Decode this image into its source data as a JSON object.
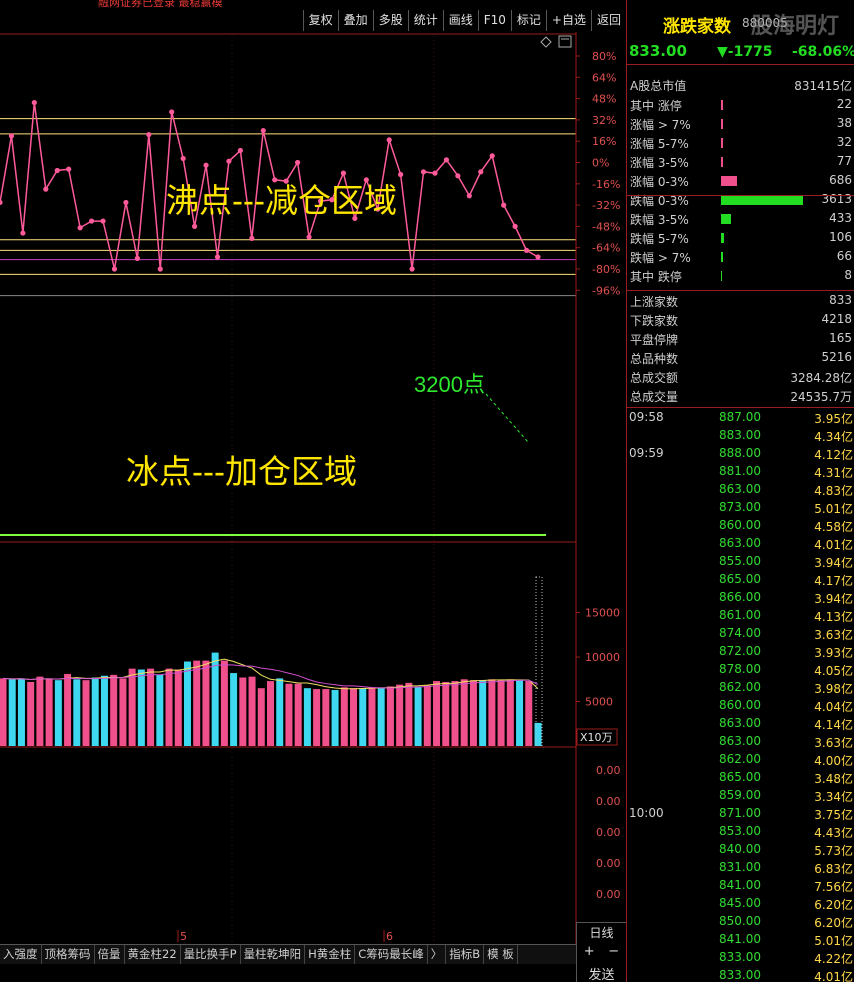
{
  "topbar": {
    "red_text": "融网证券已登录 最稳赢模",
    "buttons": [
      "复权",
      "叠加",
      "多股",
      "统计",
      "画线",
      "F10",
      "标记",
      "+自选",
      "返回"
    ]
  },
  "annotations": {
    "boil": "沸点---减仓区域",
    "ice": "冰点---加仓区域",
    "point_3200": "3200点"
  },
  "y_axis_labels": [
    "80%",
    "64%",
    "48%",
    "32%",
    "16%",
    "0%",
    "-16%",
    "-32%",
    "-48%",
    "-64%",
    "-80%",
    "-96%"
  ],
  "volume_axis": {
    "labels": [
      "15000",
      "10000",
      "5000"
    ],
    "unit": "X10万"
  },
  "indicator_axis_labels": [
    "0.00",
    "0.00",
    "0.00",
    "0.00",
    "0.00"
  ],
  "date_labels": [
    "5",
    "6"
  ],
  "bottom_tabs": [
    "入强度",
    "顶格筹码",
    "倍量",
    "黄金柱22",
    "量比换手P",
    "量柱乾坤阳",
    "H黄金柱",
    "C筹码最长峰",
    "〉",
    "指标B",
    "模 板"
  ],
  "bottom_right": {
    "line_label": "日线",
    "send_label": "发送",
    "plus": "+",
    "minus": "−"
  },
  "colors": {
    "up": "#f0508c",
    "down": "#3ed8f0",
    "band_yellow": "#ffe27a",
    "band_magenta": "#c640c0",
    "band_green": "#80ff40",
    "line": "#ff5a9a"
  },
  "chart_data": {
    "type": "line",
    "series": [
      {
        "values": [
          -30,
          20,
          -53,
          45,
          -20,
          -6,
          -5,
          -49,
          -44,
          -44,
          -80,
          -30,
          -72,
          21,
          -80,
          38,
          3,
          -48,
          -2,
          -71,
          1,
          9,
          -57,
          24,
          -13,
          -14,
          0,
          -56,
          -29,
          -28,
          -8,
          -42,
          -13,
          -35,
          17,
          -9,
          -80,
          -7,
          -8,
          2,
          -10,
          -25,
          -7,
          5,
          -32,
          -48,
          -66,
          -71
        ]
      }
    ],
    "ylim": [
      -104,
      88
    ],
    "volume": [
      7600,
      7500,
      7600,
      7200,
      7800,
      7600,
      7400,
      8100,
      7500,
      7400,
      7700,
      7900,
      8000,
      7600,
      8700,
      8600,
      8700,
      8000,
      8700,
      8600,
      9500,
      9600,
      9600,
      10500,
      9600,
      8200,
      7700,
      7800,
      6500,
      7300,
      7600,
      7000,
      7000,
      6500,
      6400,
      6400,
      6300,
      6600,
      6500,
      6500,
      6600,
      6500,
      6700,
      6900,
      7100,
      6700,
      6800,
      7300,
      7200,
      7300,
      7500,
      7400,
      7400,
      7500,
      7400,
      7500,
      7400,
      7300,
      2600
    ],
    "volume_up": [
      1,
      0,
      0,
      1,
      1,
      1,
      0,
      1,
      0,
      1,
      0,
      0,
      1,
      1,
      1,
      0,
      1,
      0,
      1,
      1,
      0,
      1,
      1,
      0,
      1,
      0,
      1,
      1,
      1,
      1,
      0,
      1,
      1,
      0,
      1,
      1,
      0,
      1,
      1,
      0,
      1,
      0,
      1,
      1,
      1,
      0,
      1,
      1,
      1,
      1,
      1,
      1,
      0,
      1,
      1,
      1,
      0,
      1,
      0
    ],
    "volume_ylim": [
      0,
      19000
    ]
  },
  "right_panel": {
    "title": "涨跌家数",
    "code": "880005",
    "watermark": "股海明灯",
    "value": "833.00",
    "change": "▼-1775",
    "pct": "-68.06%",
    "market_cap": {
      "label": "A股总市值",
      "value": "831415亿"
    },
    "rows": [
      {
        "label": "其中 涨停",
        "value": "22",
        "bar": 2,
        "color": "#f0508c"
      },
      {
        "label": "涨幅 > 7%",
        "value": "38",
        "bar": 2,
        "color": "#f0508c"
      },
      {
        "label": "涨幅 5-7%",
        "value": "32",
        "bar": 2,
        "color": "#f0508c"
      },
      {
        "label": "涨幅 3-5%",
        "value": "77",
        "bar": 2,
        "color": "#f0508c"
      },
      {
        "label": "涨幅 0-3%",
        "value": "686",
        "bar": 16,
        "color": "#f0508c"
      },
      {
        "label": "跌幅 0-3%",
        "value": "3613",
        "bar": 82,
        "color": "#22dd22"
      },
      {
        "label": "跌幅 3-5%",
        "value": "433",
        "bar": 10,
        "color": "#22dd22"
      },
      {
        "label": "跌幅 5-7%",
        "value": "106",
        "bar": 3,
        "color": "#22dd22"
      },
      {
        "label": "跌幅 > 7%",
        "value": "66",
        "bar": 2,
        "color": "#22dd22"
      },
      {
        "label": "其中 跌停",
        "value": "8",
        "bar": 1,
        "color": "#22dd22"
      }
    ],
    "stats": [
      {
        "label": "上涨家数",
        "value": "833"
      },
      {
        "label": "下跌家数",
        "value": "4218"
      },
      {
        "label": "平盘停牌",
        "value": "165"
      },
      {
        "label": "总品种数",
        "value": "5216"
      },
      {
        "label": "总成交额",
        "value": "3284.28亿"
      },
      {
        "label": "总成交量",
        "value": "24535.7万"
      }
    ],
    "ticks": [
      {
        "t": "09:58",
        "p": "887.00",
        "a": "3.95亿"
      },
      {
        "t": "",
        "p": "883.00",
        "a": "4.34亿"
      },
      {
        "t": "09:59",
        "p": "888.00",
        "a": "4.12亿"
      },
      {
        "t": "",
        "p": "881.00",
        "a": "4.31亿"
      },
      {
        "t": "",
        "p": "863.00",
        "a": "4.83亿"
      },
      {
        "t": "",
        "p": "873.00",
        "a": "5.01亿"
      },
      {
        "t": "",
        "p": "860.00",
        "a": "4.58亿"
      },
      {
        "t": "",
        "p": "863.00",
        "a": "4.01亿"
      },
      {
        "t": "",
        "p": "855.00",
        "a": "3.94亿"
      },
      {
        "t": "",
        "p": "865.00",
        "a": "4.17亿"
      },
      {
        "t": "",
        "p": "866.00",
        "a": "3.94亿"
      },
      {
        "t": "",
        "p": "861.00",
        "a": "4.13亿"
      },
      {
        "t": "",
        "p": "874.00",
        "a": "3.63亿"
      },
      {
        "t": "",
        "p": "872.00",
        "a": "3.93亿"
      },
      {
        "t": "",
        "p": "878.00",
        "a": "4.05亿"
      },
      {
        "t": "",
        "p": "862.00",
        "a": "3.98亿"
      },
      {
        "t": "",
        "p": "860.00",
        "a": "4.04亿"
      },
      {
        "t": "",
        "p": "863.00",
        "a": "4.14亿"
      },
      {
        "t": "",
        "p": "863.00",
        "a": "3.63亿"
      },
      {
        "t": "",
        "p": "862.00",
        "a": "4.00亿"
      },
      {
        "t": "",
        "p": "865.00",
        "a": "3.48亿"
      },
      {
        "t": "",
        "p": "859.00",
        "a": "3.34亿"
      },
      {
        "t": "10:00",
        "p": "871.00",
        "a": "3.75亿"
      },
      {
        "t": "",
        "p": "853.00",
        "a": "4.43亿"
      },
      {
        "t": "",
        "p": "840.00",
        "a": "5.73亿"
      },
      {
        "t": "",
        "p": "831.00",
        "a": "6.83亿"
      },
      {
        "t": "",
        "p": "841.00",
        "a": "7.56亿"
      },
      {
        "t": "",
        "p": "845.00",
        "a": "6.20亿"
      },
      {
        "t": "",
        "p": "850.00",
        "a": "6.20亿"
      },
      {
        "t": "",
        "p": "841.00",
        "a": "5.01亿"
      },
      {
        "t": "",
        "p": "833.00",
        "a": "4.22亿"
      },
      {
        "t": "",
        "p": "833.00",
        "a": "4.01亿"
      }
    ]
  }
}
